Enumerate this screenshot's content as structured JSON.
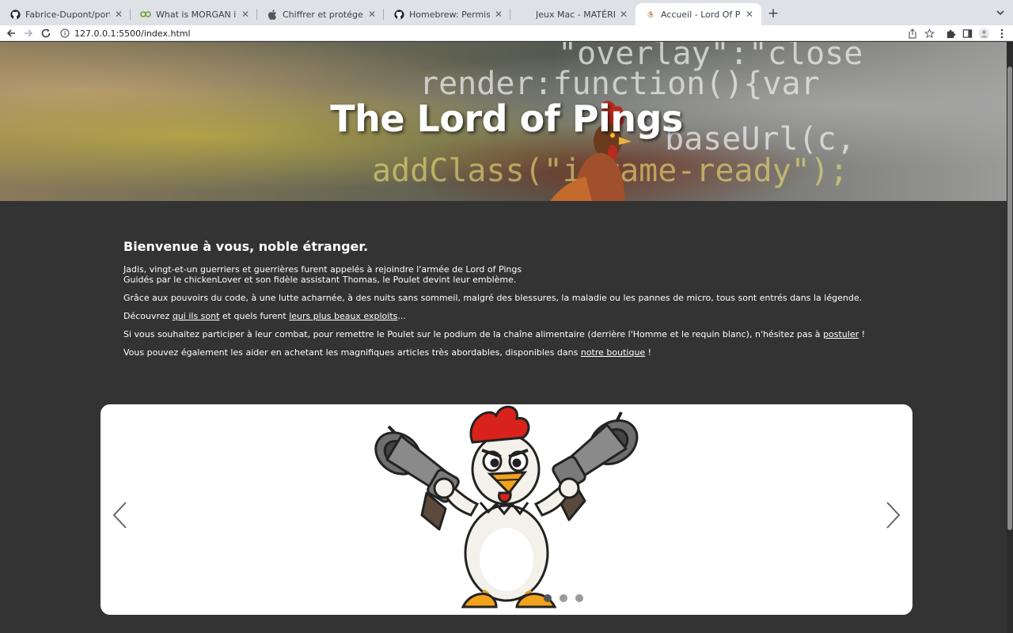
{
  "browser": {
    "tabs": [
      {
        "title": "Fabrice-Dupont/portfolio-lokoi",
        "icon": "github-icon"
      },
      {
        "title": "What is MORGAN in Node.js ?",
        "icon": "mean-icon"
      },
      {
        "title": "Chiffrer et protéger un périphé",
        "icon": "apple-icon"
      },
      {
        "title": "Homebrew: Permissions Denied",
        "icon": "github-icon"
      },
      {
        "title": "Jeux Mac - MATÉRIEL - MacG",
        "icon": "macg-icon"
      },
      {
        "title": "Accueil - Lord Of Pings",
        "icon": "chicken-favicon"
      }
    ],
    "active_tab": 5,
    "new_tab_label": "+",
    "url": "127.0.0.1:5500/index.html"
  },
  "hero": {
    "title": "The Lord of Pings",
    "background_code": [
      "\"overlay\":\"close",
      "render:function(){var",
      "baseUrl(c,",
      "addClass(\"iframe-ready\");"
    ]
  },
  "main": {
    "heading": "Bienvenue à vous, noble étranger.",
    "intro_line1": "Jadis, vingt-et-un guerriers et guerrières furent appelés à rejoindre l'armée de Lord of Pings",
    "intro_line2": "Guidés par le chickenLover et son fidèle assistant Thomas, le Poulet devint leur emblème.",
    "para2": "Grâce aux pouvoirs du code, à une lutte acharnée, à des nuits sans sommeil, malgré des blessures, la maladie ou les pannes de micro, tous sont entrés dans la légende.",
    "para3": {
      "before": "Découvrez ",
      "link1": "qui ils sont",
      "middle": " et quels furent ",
      "link2": "leurs plus beaux exploits",
      "after": "..."
    },
    "para4": {
      "before": "Si vous souhaitez participer à leur combat, pour remettre le Poulet sur le podium de la chaîne alimentaire (derrière l'Homme et le requin blanc), n'hésitez pas à ",
      "link": "postuler",
      "after": " !"
    },
    "para5": {
      "before": "Vous pouvez également les aider en achetant les magnifiques articles très abordables, disponibles dans ",
      "link": "notre boutique",
      "after": " !"
    }
  },
  "carousel": {
    "image": "angry-chicken-with-revolvers",
    "slide_count": 3,
    "active_slide": 0
  },
  "colors": {
    "page_background": "#333333",
    "text": "#ffffff",
    "carousel_background": "#ffffff",
    "tab_strip": "#dee1e6"
  }
}
